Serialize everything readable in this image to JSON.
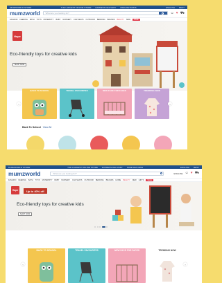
{
  "topbar": {
    "left": "MUMZWORLD STORE",
    "middle": [
      "THE LARGEST ONLINE STORE",
      "EXPRESS DELIVERY",
      "FREE RETURNS"
    ],
    "right": [
      "ENGLISH",
      "BEST"
    ]
  },
  "header": {
    "logo": "mumzworld",
    "search_placeholder": "What are you looking for?",
    "icons": [
      "search-icon",
      "user-icon",
      "heart-icon",
      "cart-icon"
    ]
  },
  "nav": {
    "items": [
      "FASHION",
      "FEEDING",
      "BATH",
      "TOYS",
      "MATERNITY",
      "BABY",
      "NURSERY",
      "CAR SEATS",
      "OUTDOOR",
      "BEDDING",
      "BRANDS",
      "HOME",
      "BEAUTY",
      "NEW",
      "GIFTS"
    ],
    "highlight": "BEAUTY",
    "sale": "SALE"
  },
  "hero1": {
    "brand": "Hape",
    "title": "Eco-friendly toys for creative kids",
    "button": "SHOP NOW"
  },
  "hero2": {
    "brand": "Hape",
    "offer": "Up to 40% off",
    "title": "Eco-friendly toys for creative kids",
    "button": "SHOP NOW"
  },
  "cards": [
    {
      "label": "BACK TO SCHOOL",
      "color": "#f4c64f"
    },
    {
      "label": "TRAVEL FAVOURITES",
      "color": "#5bc3c9"
    },
    {
      "label": "NEW FACE FOR FACES",
      "color": "#f3a6b8"
    },
    {
      "label": "TRENDING NOW",
      "color": "#c5a3d6"
    }
  ],
  "section": {
    "title": "Back To School",
    "link": "View All"
  },
  "colors": {
    "background": "#f6dc6e",
    "brand_blue": "#1f4f8a",
    "sale_red": "#e13c4c"
  }
}
